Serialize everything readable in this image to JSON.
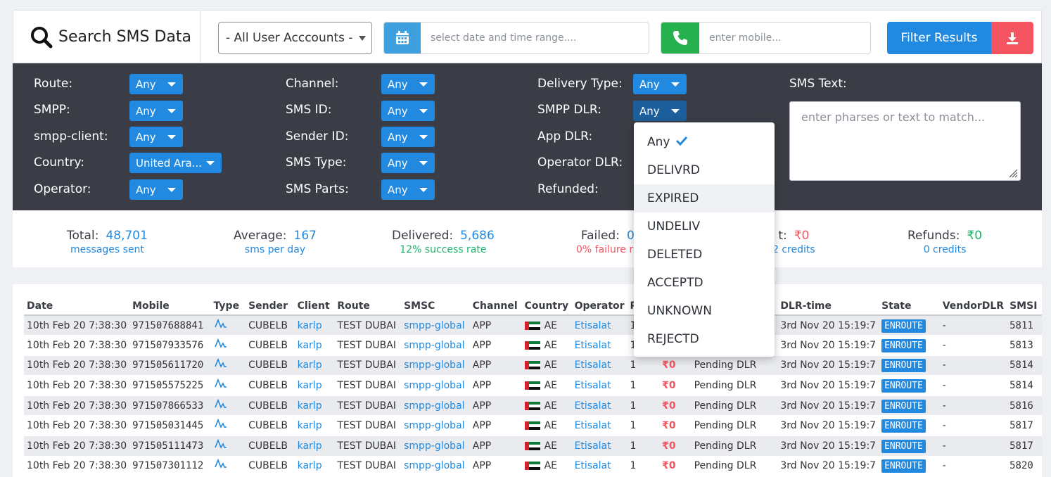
{
  "header": {
    "title": "Search SMS Data",
    "user_select": "- All User Acccounts -",
    "date_placeholder": "select date and time range....",
    "mobile_placeholder": "enter mobile...",
    "filter_button": "Filter Results"
  },
  "filters": {
    "col1": [
      {
        "label": "Route:",
        "value": "Any"
      },
      {
        "label": "SMPP:",
        "value": "Any"
      },
      {
        "label": "smpp-client:",
        "value": "Any"
      },
      {
        "label": "Country:",
        "value": "United Ara..."
      },
      {
        "label": "Operator:",
        "value": "Any"
      }
    ],
    "col2": [
      {
        "label": "Channel:",
        "value": "Any"
      },
      {
        "label": "SMS ID:",
        "value": "Any"
      },
      {
        "label": "Sender ID:",
        "value": "Any"
      },
      {
        "label": "SMS Type:",
        "value": "Any"
      },
      {
        "label": "SMS Parts:",
        "value": "Any"
      }
    ],
    "col3": [
      {
        "label": "Delivery Type:",
        "value": "Any"
      },
      {
        "label": "SMPP DLR:",
        "value": "Any"
      },
      {
        "label": "App DLR:"
      },
      {
        "label": "Operator DLR:"
      },
      {
        "label": "Refunded:"
      }
    ],
    "sms_text_label": "SMS Text:",
    "sms_text_placeholder": "enter pharses or text to match..."
  },
  "dropdown": {
    "items": [
      "Any",
      "DELIVRD",
      "EXPIRED",
      "UNDELIV",
      "DELETED",
      "ACCEPTD",
      "UNKNOWN",
      "REJECTD"
    ],
    "selected": "Any",
    "hovered": "EXPIRED"
  },
  "stats": {
    "total": {
      "label": "Total:",
      "value": "48,701",
      "sub": "messages sent"
    },
    "average": {
      "label": "Average:",
      "value": "167",
      "sub": "sms per day"
    },
    "delivered": {
      "label": "Delivered:",
      "value": "5,686",
      "sub": "12% success rate"
    },
    "failed": {
      "label": "Failed:",
      "value": "0",
      "sub": "0% failure ra"
    },
    "cost": {
      "label": "t:",
      "value": "₹0",
      "sub": "2 credits"
    },
    "refunds": {
      "label": "Refunds:",
      "value": "₹0",
      "sub": "0 credits"
    }
  },
  "table": {
    "headers": [
      "Date",
      "Mobile",
      "Type",
      "Sender",
      "Client",
      "Route",
      "SMSC",
      "Channel",
      "Country",
      "Operator",
      "P",
      "",
      "",
      "DLR-time",
      "State",
      "VendorDLR",
      "SMSI"
    ],
    "rows": [
      {
        "date": "10th Feb 20 7:38:30",
        "mobile": "971507688841",
        "sender": "CUBELB",
        "client": "karlp",
        "route": "TEST DUBAI",
        "smsc": "smpp-global",
        "channel": "APP",
        "country": "AE",
        "operator": "Etisalat",
        "parts": "1",
        "cost": "",
        "dlr": "",
        "dlr_time": "3rd Nov 20 15:19:7",
        "state": "ENROUTE",
        "vendor": "-",
        "smsid": "5811"
      },
      {
        "date": "10th Feb 20 7:38:30",
        "mobile": "971507933576",
        "sender": "CUBELB",
        "client": "karlp",
        "route": "TEST DUBAI",
        "smsc": "smpp-global",
        "channel": "APP",
        "country": "AE",
        "operator": "Etisalat",
        "parts": "1",
        "cost": "",
        "dlr": "",
        "dlr_time": "3rd Nov 20 15:19:7",
        "state": "ENROUTE",
        "vendor": "-",
        "smsid": "5813"
      },
      {
        "date": "10th Feb 20 7:38:30",
        "mobile": "971505611720",
        "sender": "CUBELB",
        "client": "karlp",
        "route": "TEST DUBAI",
        "smsc": "smpp-global",
        "channel": "APP",
        "country": "AE",
        "operator": "Etisalat",
        "parts": "1",
        "cost": "₹0",
        "dlr": "Pending DLR",
        "dlr_time": "3rd Nov 20 15:19:7",
        "state": "ENROUTE",
        "vendor": "-",
        "smsid": "5814"
      },
      {
        "date": "10th Feb 20 7:38:30",
        "mobile": "971505575225",
        "sender": "CUBELB",
        "client": "karlp",
        "route": "TEST DUBAI",
        "smsc": "smpp-global",
        "channel": "APP",
        "country": "AE",
        "operator": "Etisalat",
        "parts": "1",
        "cost": "₹0",
        "dlr": "Pending DLR",
        "dlr_time": "3rd Nov 20 15:19:7",
        "state": "ENROUTE",
        "vendor": "-",
        "smsid": "5814"
      },
      {
        "date": "10th Feb 20 7:38:30",
        "mobile": "971507866533",
        "sender": "CUBELB",
        "client": "karlp",
        "route": "TEST DUBAI",
        "smsc": "smpp-global",
        "channel": "APP",
        "country": "AE",
        "operator": "Etisalat",
        "parts": "1",
        "cost": "₹0",
        "dlr": "Pending DLR",
        "dlr_time": "3rd Nov 20 15:19:7",
        "state": "ENROUTE",
        "vendor": "-",
        "smsid": "5816"
      },
      {
        "date": "10th Feb 20 7:38:30",
        "mobile": "971505031445",
        "sender": "CUBELB",
        "client": "karlp",
        "route": "TEST DUBAI",
        "smsc": "smpp-global",
        "channel": "APP",
        "country": "AE",
        "operator": "Etisalat",
        "parts": "1",
        "cost": "₹0",
        "dlr": "Pending DLR",
        "dlr_time": "3rd Nov 20 15:19:7",
        "state": "ENROUTE",
        "vendor": "-",
        "smsid": "5817"
      },
      {
        "date": "10th Feb 20 7:38:30",
        "mobile": "971505111473",
        "sender": "CUBELB",
        "client": "karlp",
        "route": "TEST DUBAI",
        "smsc": "smpp-global",
        "channel": "APP",
        "country": "AE",
        "operator": "Etisalat",
        "parts": "1",
        "cost": "₹0",
        "dlr": "Pending DLR",
        "dlr_time": "3rd Nov 20 15:19:7",
        "state": "ENROUTE",
        "vendor": "-",
        "smsid": "5817"
      },
      {
        "date": "10th Feb 20 7:38:30",
        "mobile": "971507301112",
        "sender": "CUBELB",
        "client": "karlp",
        "route": "TEST DUBAI",
        "smsc": "smpp-global",
        "channel": "APP",
        "country": "AE",
        "operator": "Etisalat",
        "parts": "1",
        "cost": "₹0",
        "dlr": "Pending DLR",
        "dlr_time": "3rd Nov 20 15:19:7",
        "state": "ENROUTE",
        "vendor": "-",
        "smsid": "5820"
      }
    ]
  },
  "colors": {
    "accent": "#2189e0",
    "panel": "#3a3d45",
    "success": "#19b46a",
    "danger": "#f4545f",
    "date_icon": "#3ea0de",
    "phone_icon": "#27b04e"
  }
}
